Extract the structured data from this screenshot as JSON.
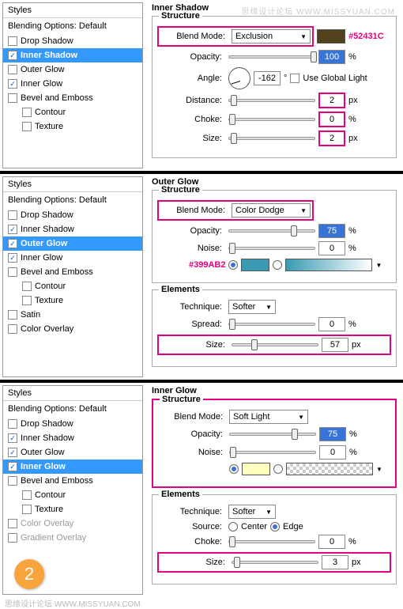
{
  "watermark": "思缘设计论坛 WWW.MISSYUAN.COM",
  "panels": {
    "title": "Styles",
    "blending": "Blending Options: Default",
    "items": [
      "Drop Shadow",
      "Inner Shadow",
      "Outer Glow",
      "Inner Glow",
      "Bevel and Emboss",
      "Contour",
      "Texture",
      "Satin",
      "Color Overlay",
      "Gradient Overlay"
    ]
  },
  "sec1": {
    "title": "Inner Shadow",
    "structure": "Structure",
    "blendModeLabel": "Blend Mode:",
    "blendMode": "Exclusion",
    "colorHex": "#52431C",
    "opacityLabel": "Opacity:",
    "opacity": "100",
    "angleLabel": "Angle:",
    "angle": "-162",
    "globalLight": "Use Global Light",
    "distanceLabel": "Distance:",
    "distance": "2",
    "chokeLabel": "Choke:",
    "choke": "0",
    "sizeLabel": "Size:",
    "size": "2",
    "pct": "%",
    "px": "px",
    "deg": "°"
  },
  "sec2": {
    "title": "Outer Glow",
    "structure": "Structure",
    "elements": "Elements",
    "blendModeLabel": "Blend Mode:",
    "blendMode": "Color Dodge",
    "opacityLabel": "Opacity:",
    "opacity": "75",
    "noiseLabel": "Noise:",
    "noise": "0",
    "colorHex": "#399AB2",
    "techniqueLabel": "Technique:",
    "technique": "Softer",
    "spreadLabel": "Spread:",
    "spread": "0",
    "sizeLabel": "Size:",
    "size": "57",
    "pct": "%",
    "px": "px"
  },
  "sec3": {
    "title": "Inner Glow",
    "structure": "Structure",
    "elements": "Elements",
    "blendModeLabel": "Blend Mode:",
    "blendMode": "Soft Light",
    "opacityLabel": "Opacity:",
    "opacity": "75",
    "noiseLabel": "Noise:",
    "noise": "0",
    "techniqueLabel": "Technique:",
    "technique": "Softer",
    "sourceLabel": "Source:",
    "sourceCenter": "Center",
    "sourceEdge": "Edge",
    "chokeLabel": "Choke:",
    "choke": "0",
    "sizeLabel": "Size:",
    "size": "3",
    "pct": "%",
    "px": "px"
  },
  "badge": "2"
}
